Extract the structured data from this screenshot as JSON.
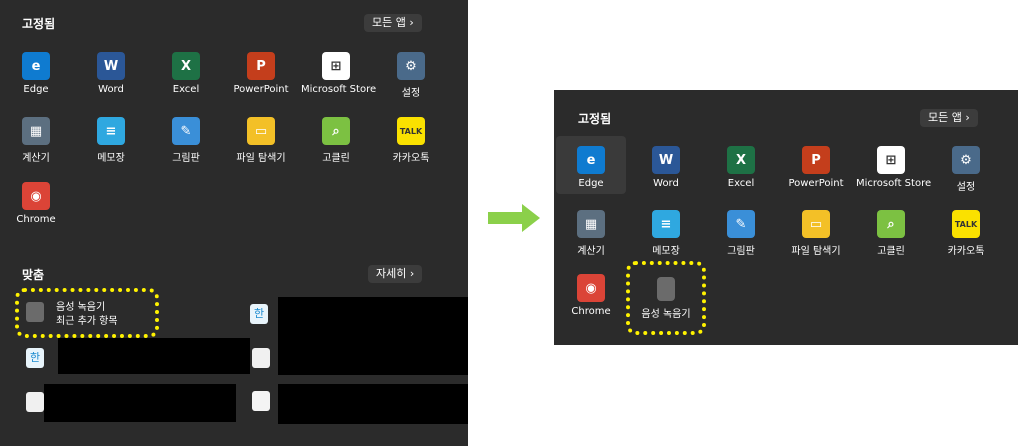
{
  "pinned_title": "고정됨",
  "all_apps": "모든 앱 ›",
  "recommended_title": "맞춤",
  "more": "자세히 ›",
  "apps": [
    {
      "label": "Edge",
      "icon": "edge-icon",
      "color": "#0f7bd0",
      "glyph": "e"
    },
    {
      "label": "Word",
      "icon": "word-icon",
      "color": "#2b5797",
      "glyph": "W"
    },
    {
      "label": "Excel",
      "icon": "excel-icon",
      "color": "#1e7145",
      "glyph": "X"
    },
    {
      "label": "PowerPoint",
      "icon": "powerpoint-icon",
      "color": "#c43e1c",
      "glyph": "P"
    },
    {
      "label": "Microsoft Store",
      "icon": "store-icon",
      "color": "#ffffff",
      "glyph": "⊞"
    },
    {
      "label": "설정",
      "icon": "gear-icon",
      "color": "#4a6a8a",
      "glyph": "⚙"
    },
    {
      "label": "계산기",
      "icon": "calculator-icon",
      "color": "#5c6f80",
      "glyph": "▦"
    },
    {
      "label": "메모장",
      "icon": "notepad-icon",
      "color": "#2fa8e0",
      "glyph": "≡"
    },
    {
      "label": "그림판",
      "icon": "paint-icon",
      "color": "#3a8fd8",
      "glyph": "✎"
    },
    {
      "label": "파일 탐색기",
      "icon": "folder-icon",
      "color": "#f3c027",
      "glyph": "▭"
    },
    {
      "label": "고클린",
      "icon": "magnifier-icon",
      "color": "#7cc142",
      "glyph": "⌕"
    },
    {
      "label": "카카오톡",
      "icon": "kakaotalk-icon",
      "color": "#fae100",
      "glyph": "TALK"
    },
    {
      "label": "Chrome",
      "icon": "chrome-icon",
      "color": "#db4437",
      "glyph": "◉"
    }
  ],
  "recorder": {
    "label": "음성 녹음기",
    "sub": "최근 추가 항목"
  },
  "recorder_new": {
    "label": "음성 녹음기"
  },
  "arrow_color": "#8bd04a",
  "highlight_color": "#fff200",
  "hangul_glyph": "한"
}
